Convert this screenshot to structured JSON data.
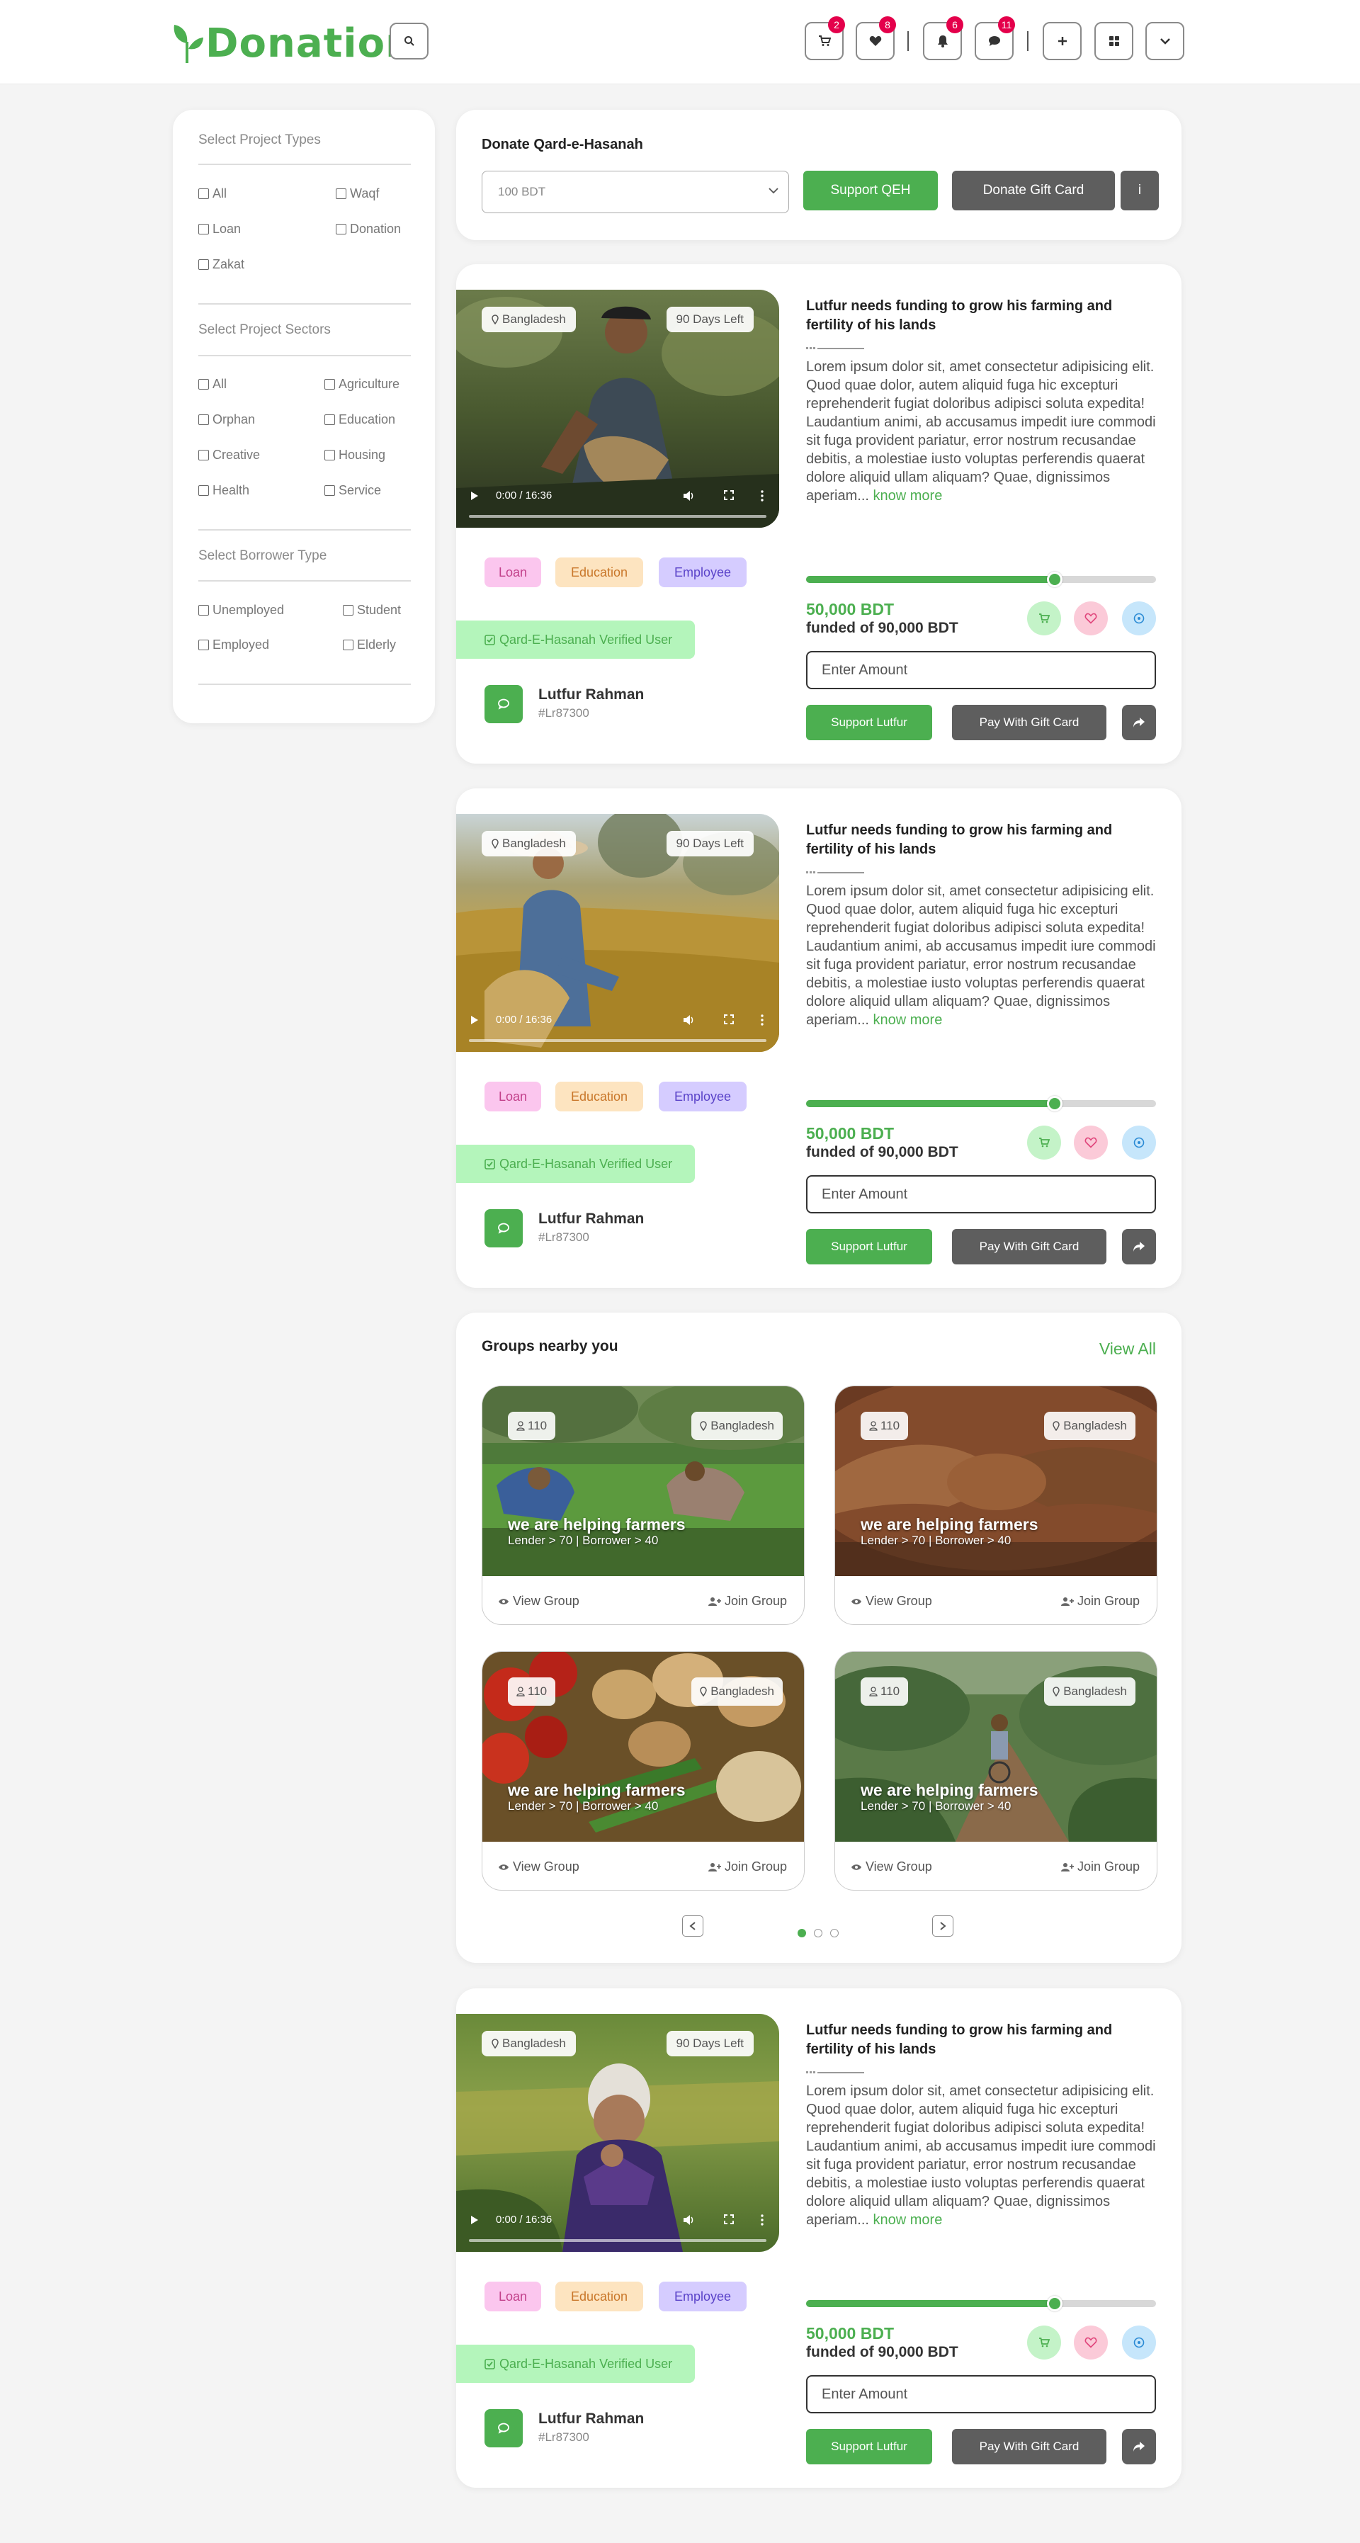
{
  "header": {
    "logo_text": "Donation",
    "cart_count": "2",
    "wishlist_count": "8",
    "notifications_count": "6",
    "messages_count": "11"
  },
  "sidebar": {
    "project_types_title": "Select Project Types",
    "project_types": [
      "All",
      "Waqf",
      "Loan",
      "Donation",
      "Zakat"
    ],
    "project_sectors_title": "Select Project Sectors",
    "project_sectors": [
      "All",
      "Agriculture",
      "Orphan",
      "Education",
      "Creative",
      "Housing",
      "Health",
      "Service"
    ],
    "borrower_type_title": "Select Borrower Type",
    "borrower_types": [
      "Unemployed",
      "Student",
      "Employed",
      "Elderly"
    ]
  },
  "qeh": {
    "title": "Donate Qard-e-Hasanah",
    "selected_amount": "100 BDT",
    "support_label": "Support QEH",
    "gift_label": "Donate Gift Card",
    "info_label": "i"
  },
  "projects": [
    {
      "location": "Bangladesh",
      "days_left": "90 Days Left",
      "video_time": "0:00 / 16:36",
      "tags": [
        "Loan",
        "Education",
        "Employee"
      ],
      "verified_label": "Qard-E-Hasanah Verified User",
      "user_name": "Lutfur Rahman",
      "user_id": "#Lr87300",
      "title": "Lutfur needs funding to grow his farming and fertility of his lands",
      "description": "Lorem ipsum dolor sit, amet consectetur adipisicing elit. Quod quae dolor, autem aliquid fuga hic excepturi reprehenderit fugiat doloribus adipisci soluta expedita! Laudantium animi, ab accusamus impedit iure commodi sit fuga provident pariatur, error nostrum recusandae debitis, a molestiae iusto voluptas perferendis quaerat dolore aliquid ullam aliquam? Quae, dignissimos aperiam...",
      "know_more": "know more",
      "funded_amount": "50,000 BDT",
      "funded_of": "funded of 90,000 BDT",
      "progress": 0.71,
      "amount_placeholder": "Enter Amount",
      "support_label": "Support Lutfur",
      "gift_label": "Pay With Gift Card"
    },
    {
      "location": "Bangladesh",
      "days_left": "90 Days Left",
      "video_time": "0:00 / 16:36",
      "tags": [
        "Loan",
        "Education",
        "Employee"
      ],
      "verified_label": "Qard-E-Hasanah Verified User",
      "user_name": "Lutfur Rahman",
      "user_id": "#Lr87300",
      "title": "Lutfur needs funding to grow his farming and fertility of his lands",
      "description": "Lorem ipsum dolor sit, amet consectetur adipisicing elit. Quod quae dolor, autem aliquid fuga hic excepturi reprehenderit fugiat doloribus adipisci soluta expedita! Laudantium animi, ab accusamus impedit iure commodi sit fuga provident pariatur, error nostrum recusandae debitis, a molestiae iusto voluptas perferendis quaerat dolore aliquid ullam aliquam? Quae, dignissimos aperiam...",
      "know_more": "know more",
      "funded_amount": "50,000 BDT",
      "funded_of": "funded of 90,000 BDT",
      "progress": 0.71,
      "amount_placeholder": "Enter Amount",
      "support_label": "Support Lutfur",
      "gift_label": "Pay With Gift Card"
    },
    {
      "location": "Bangladesh",
      "days_left": "90 Days Left",
      "video_time": "0:00 / 16:36",
      "tags": [
        "Loan",
        "Education",
        "Employee"
      ],
      "verified_label": "Qard-E-Hasanah Verified User",
      "user_name": "Lutfur Rahman",
      "user_id": "#Lr87300",
      "title": "Lutfur needs funding to grow his farming and fertility of his lands",
      "description": "Lorem ipsum dolor sit, amet consectetur adipisicing elit. Quod quae dolor, autem aliquid fuga hic excepturi reprehenderit fugiat doloribus adipisci soluta expedita! Laudantium animi, ab accusamus impedit iure commodi sit fuga provident pariatur, error nostrum recusandae debitis, a molestiae iusto voluptas perferendis quaerat dolore aliquid ullam aliquam? Quae, dignissimos aperiam...",
      "know_more": "know more",
      "funded_amount": "50,000 BDT",
      "funded_of": "funded of 90,000 BDT",
      "progress": 0.71,
      "amount_placeholder": "Enter Amount",
      "support_label": "Support Lutfur",
      "gift_label": "Pay With Gift Card"
    }
  ],
  "groups": {
    "title": "Groups nearby you",
    "view_all": "View All",
    "items": [
      {
        "count": "110",
        "location": "Bangladesh",
        "name": "we are helping farmers",
        "sub": "Lender > 70 | Borrower > 40",
        "view_label": "View Group",
        "join_label": "Join Group"
      },
      {
        "count": "110",
        "location": "Bangladesh",
        "name": "we are helping farmers",
        "sub": "Lender > 70 | Borrower > 40",
        "view_label": "View Group",
        "join_label": "Join Group"
      },
      {
        "count": "110",
        "location": "Bangladesh",
        "name": "we are helping farmers",
        "sub": "Lender > 70 | Borrower > 40",
        "view_label": "View Group",
        "join_label": "Join Group"
      },
      {
        "count": "110",
        "location": "Bangladesh",
        "name": "we are helping farmers",
        "sub": "Lender > 70 | Borrower > 40",
        "view_label": "View Group",
        "join_label": "Join Group"
      }
    ],
    "page_count": 3,
    "active_page": 1
  },
  "colors": {
    "brand_green": "#4caf50",
    "dark_button": "#5e5e5e",
    "badge_red": "#e4004b",
    "tag_loan_bg": "#fbc6ee",
    "tag_education_bg": "#fde4c0",
    "tag_employee_bg": "#d5ccff",
    "verified_bg": "#b4f5bb"
  }
}
